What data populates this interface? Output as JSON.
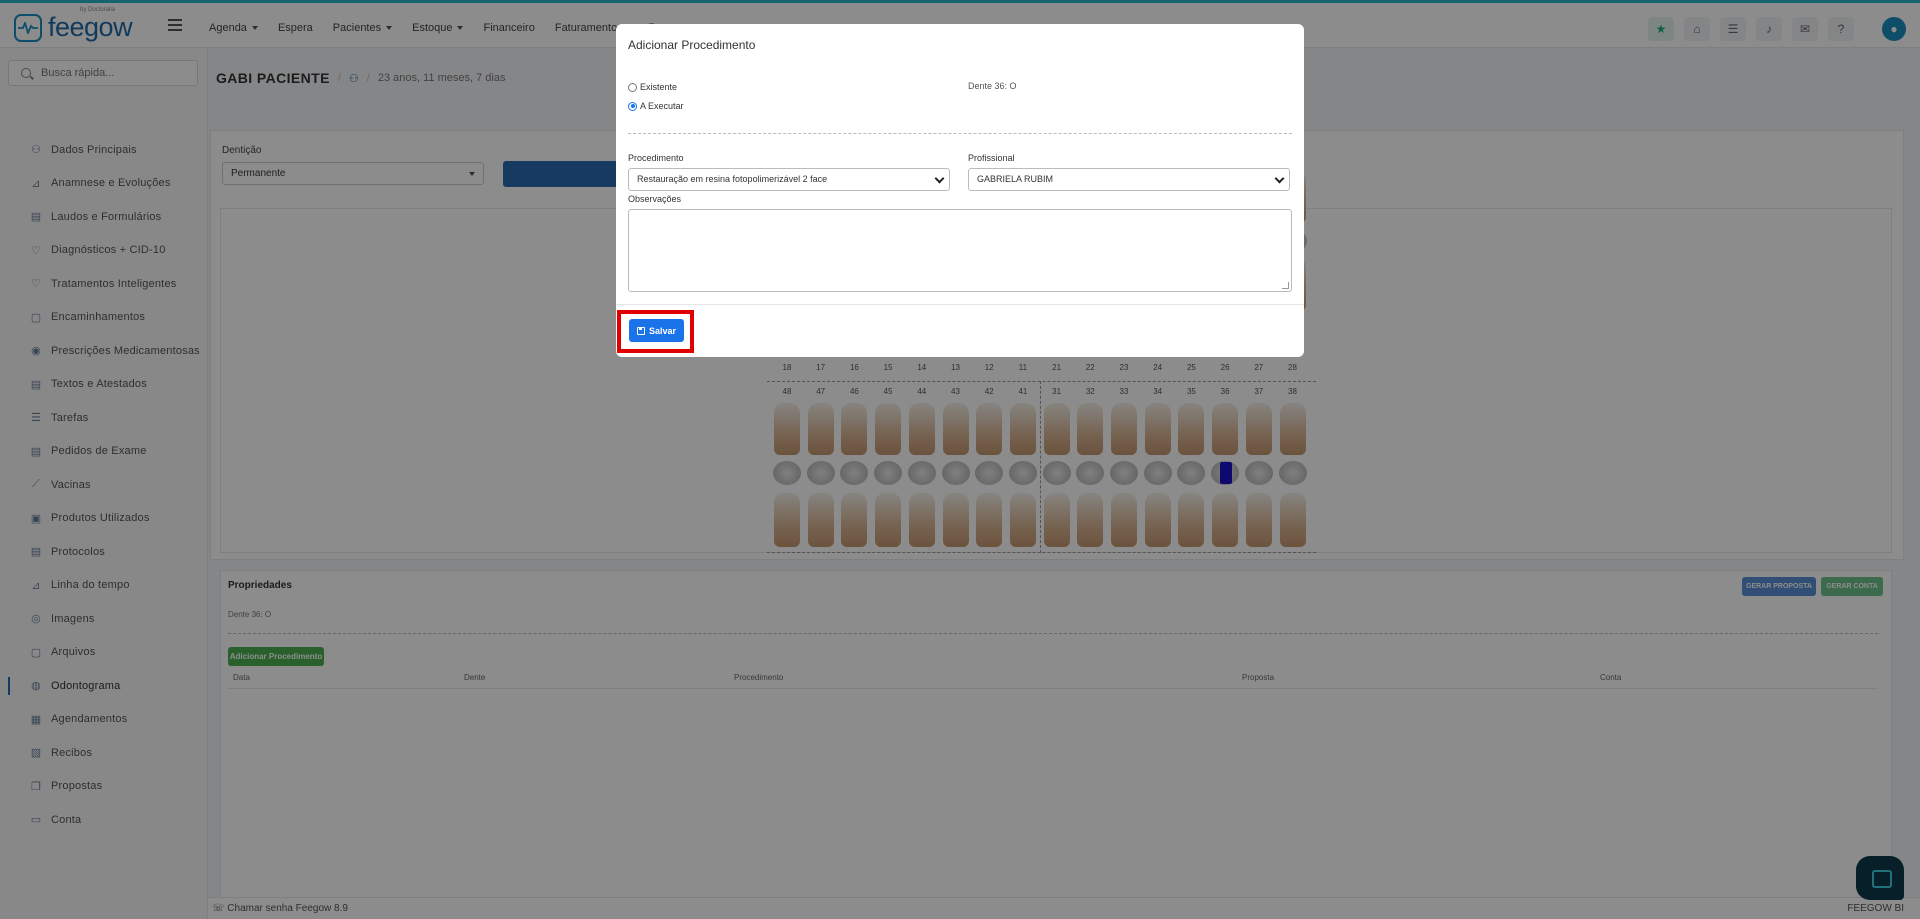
{
  "app": {
    "logo_text": "feegow",
    "logo_by": "by Doctoralia"
  },
  "nav": {
    "items": [
      "Agenda",
      "Espera",
      "Pacientes",
      "Estoque",
      "Financeiro",
      "Faturamento",
      "Re"
    ]
  },
  "sidebar": {
    "search_placeholder": "Busca rápida...",
    "items": [
      {
        "label": "Dados Principais",
        "icon": "user-icon"
      },
      {
        "label": "Anamnese e Evoluções",
        "icon": "chart-icon"
      },
      {
        "label": "Laudos e Formulários",
        "icon": "clipboard-icon"
      },
      {
        "label": "Diagnósticos + CID-10",
        "icon": "stethoscope-icon"
      },
      {
        "label": "Tratamentos Inteligentes",
        "icon": "stethoscope-icon"
      },
      {
        "label": "Encaminhamentos",
        "icon": "file-icon"
      },
      {
        "label": "Prescrições Medicamentosas",
        "icon": "pills-icon"
      },
      {
        "label": "Textos e Atestados",
        "icon": "document-icon"
      },
      {
        "label": "Tarefas",
        "icon": "list-icon"
      },
      {
        "label": "Pedidos de Exame",
        "icon": "document-icon"
      },
      {
        "label": "Vacinas",
        "icon": "syringe-icon"
      },
      {
        "label": "Produtos Utilizados",
        "icon": "box-icon"
      },
      {
        "label": "Protocolos",
        "icon": "clipboard-icon"
      },
      {
        "label": "Linha do tempo",
        "icon": "timeline-icon"
      },
      {
        "label": "Imagens",
        "icon": "camera-icon"
      },
      {
        "label": "Arquivos",
        "icon": "file-icon"
      },
      {
        "label": "Odontograma",
        "icon": "tooth-icon"
      },
      {
        "label": "Agendamentos",
        "icon": "calendar-icon"
      },
      {
        "label": "Recibos",
        "icon": "receipt-icon"
      },
      {
        "label": "Propostas",
        "icon": "copy-icon"
      },
      {
        "label": "Conta",
        "icon": "money-icon"
      }
    ],
    "active_index": 16
  },
  "patient": {
    "name": "GABI PACIENTE",
    "age": "23 anos, 11 meses, 7 dias"
  },
  "odontogram": {
    "denticao_label": "Dentição",
    "denticao_value": "Permanente",
    "upper_numbers": [
      "18",
      "17",
      "16",
      "15",
      "14",
      "13",
      "12",
      "11",
      "21",
      "22",
      "23",
      "24",
      "25",
      "26",
      "27",
      "28"
    ],
    "lower_numbers": [
      "48",
      "47",
      "46",
      "45",
      "44",
      "43",
      "42",
      "41",
      "31",
      "32",
      "33",
      "34",
      "35",
      "36",
      "37",
      "38"
    ]
  },
  "properties": {
    "title": "Propriedades",
    "dente_info": "Dente 36: O",
    "gerar_proposta": "GERAR PROPOSTA",
    "gerar_conta": "GERAR CONTA",
    "add_button": "Adicionar Procedimento",
    "columns": [
      "Data",
      "Dente",
      "Procedimento",
      "Proposta",
      "Conta"
    ]
  },
  "footer": {
    "left": "Chamar senha  Feegow 8.9",
    "right": "FEEGOW BI"
  },
  "modal": {
    "title": "Adicionar Procedimento",
    "radio_existente": "Existente",
    "radio_executar": "A Executar",
    "dente_info": "Dente 36: O",
    "procedimento_label": "Procedimento",
    "procedimento_value": "Restauração em resina fotopolimerizável 2 face",
    "profissional_label": "Profissional",
    "profissional_value": "GABRIELA RUBIM",
    "observacoes_label": "Observações",
    "save_label": "Salvar"
  },
  "colors": {
    "primary": "#1a73e8",
    "highlight": "#e00000",
    "success": "#4caf50"
  }
}
